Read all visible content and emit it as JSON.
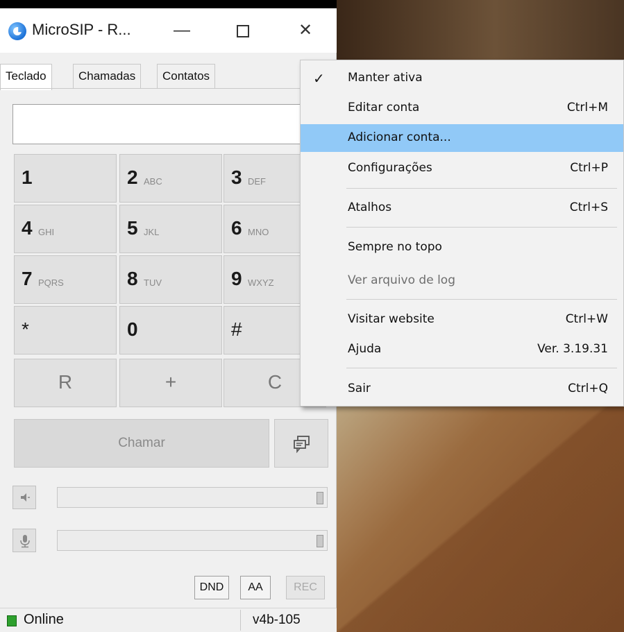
{
  "window": {
    "title": "MicroSIP - R...",
    "minimize_glyph": "—",
    "close_glyph": "✕"
  },
  "tabs": [
    {
      "label": "Teclado"
    },
    {
      "label": "Chamadas"
    },
    {
      "label": "Contatos"
    }
  ],
  "dialpad": {
    "number_value": "",
    "keys": [
      {
        "digit": "1",
        "letters": ""
      },
      {
        "digit": "2",
        "letters": "ABC"
      },
      {
        "digit": "3",
        "letters": "DEF"
      },
      {
        "digit": "4",
        "letters": "GHI"
      },
      {
        "digit": "5",
        "letters": "JKL"
      },
      {
        "digit": "6",
        "letters": "MNO"
      },
      {
        "digit": "7",
        "letters": "PQRS"
      },
      {
        "digit": "8",
        "letters": "TUV"
      },
      {
        "digit": "9",
        "letters": "WXYZ"
      },
      {
        "digit": "*",
        "letters": ""
      },
      {
        "digit": "0",
        "letters": ""
      },
      {
        "digit": "#",
        "letters": ""
      },
      {
        "digit": "R",
        "letters": ""
      },
      {
        "digit": "+",
        "letters": ""
      },
      {
        "digit": "C",
        "letters": ""
      }
    ]
  },
  "call": {
    "call_label": "Chamar"
  },
  "toggles": {
    "dnd": "DND",
    "aa": "AA",
    "rec": "REC"
  },
  "status": {
    "state": "Online",
    "version": "v4b-105",
    "color": "#2ea02e"
  },
  "menu": {
    "items": [
      {
        "label": "Manter ativa",
        "shortcut": "",
        "checked": true
      },
      {
        "label": "Editar conta",
        "shortcut": "Ctrl+M"
      },
      {
        "label": "Adicionar conta...",
        "shortcut": "",
        "highlighted": true
      },
      {
        "label": "Configurações",
        "shortcut": "Ctrl+P"
      },
      {
        "label": "Atalhos",
        "shortcut": "Ctrl+S"
      },
      {
        "label": "Sempre no topo",
        "shortcut": ""
      },
      {
        "label": "Ver arquivo de log",
        "shortcut": "",
        "disabled": true
      },
      {
        "label": "Visitar website",
        "shortcut": "Ctrl+W"
      },
      {
        "label": "Ajuda",
        "shortcut": "Ver. 3.19.31"
      },
      {
        "label": "Sair",
        "shortcut": "Ctrl+Q"
      }
    ],
    "highlight_color": "#91c9f7"
  }
}
